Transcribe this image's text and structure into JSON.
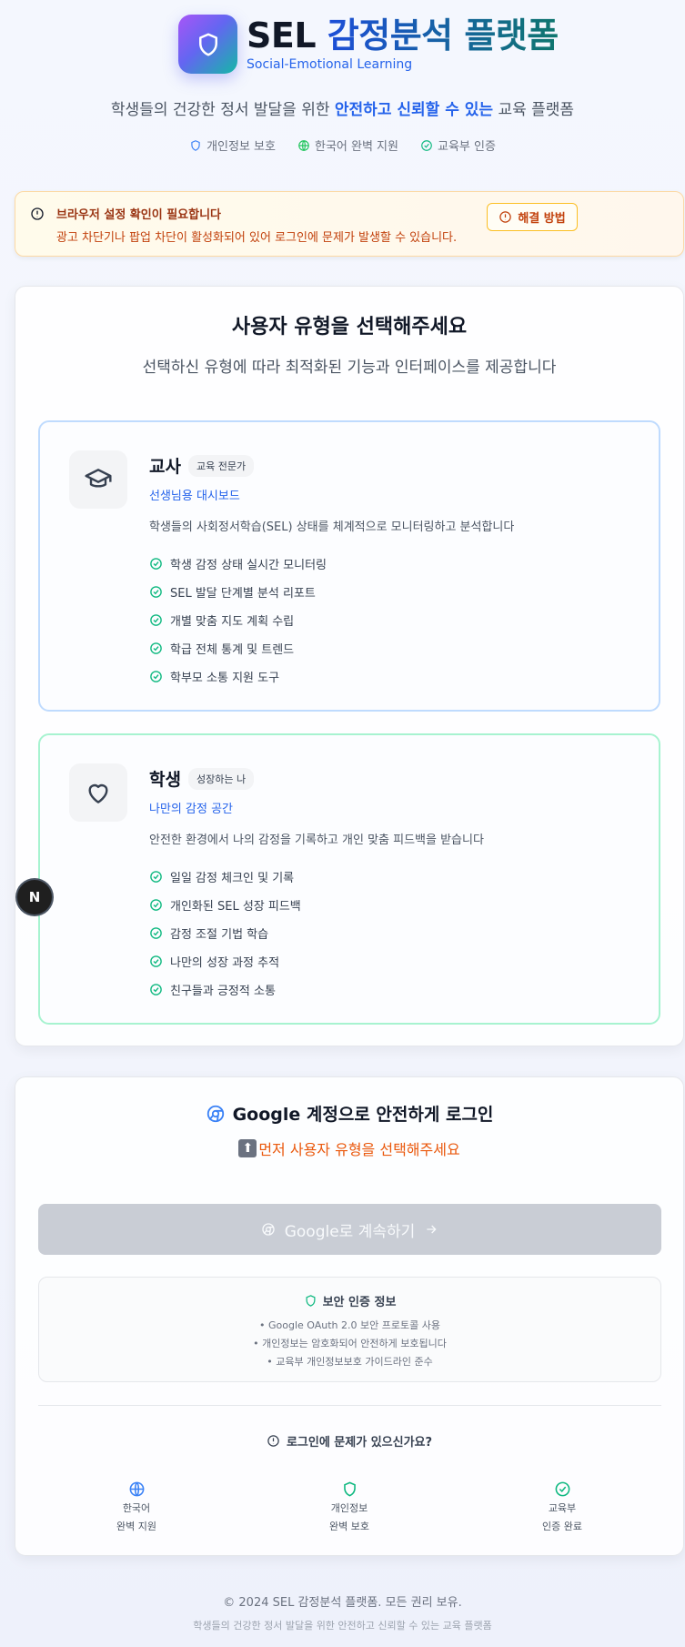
{
  "header": {
    "brand_sel": "SEL",
    "brand_ko": "감정분석 플랫폼",
    "brand_sub": "Social-Emotional Learning",
    "tagline_pre": "학생들의 건강한 정서 발달을 위한",
    "tagline_hl": "안전하고 신뢰할 수 있는",
    "tagline_post": "교육 플랫폼",
    "badges": [
      "개인정보 보호",
      "한국어 완벽 지원",
      "교육부 인증"
    ]
  },
  "warning": {
    "title": "브라우저 설정 확인이 필요합니다",
    "desc": "광고 차단기나 팝업 차단이 활성화되어 있어 로그인에 문제가 발생할 수 있습니다.",
    "button": "해결 방법"
  },
  "select": {
    "title": "사용자 유형을 선택해주세요",
    "subtitle": "선택하신 유형에 따라 최적화된 기능과 인터페이스를 제공합니다",
    "roles": [
      {
        "name": "교사",
        "chip": "교육 전문가",
        "link": "선생님용 대시보드",
        "desc": "학생들의 사회정서학습(SEL) 상태를 체계적으로 모니터링하고 분석합니다",
        "features": [
          "학생 감정 상태 실시간 모니터링",
          "SEL 발달 단계별 분석 리포트",
          "개별 맞춤 지도 계획 수립",
          "학급 전체 통계 및 트렌드",
          "학부모 소통 지원 도구"
        ]
      },
      {
        "name": "학생",
        "chip": "성장하는 나",
        "link": "나만의 감정 공간",
        "desc": "안전한 환경에서 나의 감정을 기록하고 개인 맞춤 피드백을 받습니다",
        "features": [
          "일일 감정 체크인 및 기록",
          "개인화된 SEL 성장 피드백",
          "감정 조절 기법 학습",
          "나만의 성장 과정 추적",
          "친구들과 긍정적 소통"
        ]
      }
    ]
  },
  "fab": {
    "label": "N"
  },
  "login": {
    "title": "Google 계정으로 안전하게 로그인",
    "hint": "먼저 사용자 유형을 선택해주세요",
    "button": "Google로 계속하기",
    "security_title": "보안 인증 정보",
    "security_items": [
      "• Google OAuth 2.0 보안 프로토콜 사용",
      "• 개인정보는 암호화되어 안전하게 보호됩니다",
      "• 교육부 개인정보보호 가이드라인 준수"
    ],
    "trouble": "로그인에 문제가 있으신가요?",
    "features": [
      {
        "line1": "한국어",
        "line2": "완벽 지원",
        "icon": "globe-icon"
      },
      {
        "line1": "개인정보",
        "line2": "완벽 보호",
        "icon": "shield-icon"
      },
      {
        "line1": "교육부",
        "line2": "인증 완료",
        "icon": "check-circle-icon"
      }
    ]
  },
  "footer": {
    "copyright": "© 2024 SEL 감정분석 플랫폼. 모든 권리 보유.",
    "tagline": "학생들의 건강한 정서 발달을 위한 안전하고 신뢰할 수 있는 교육 플랫폼"
  },
  "colors": {
    "accent": "#2563eb",
    "teacher_border": "#bfdbfe",
    "student_border": "#a7f3d0",
    "check": "#10b981",
    "warning_text": "#c2410c"
  }
}
